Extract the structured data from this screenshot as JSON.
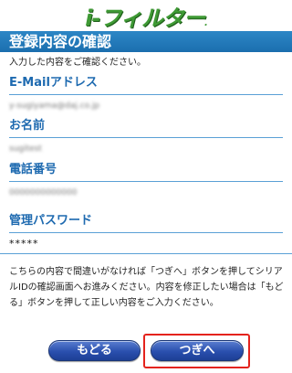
{
  "header": {
    "logo_text": "i-フィルター",
    "logo_mark": "."
  },
  "title": "登録内容の確認",
  "intro": "入力した内容をご確認ください。",
  "fields": [
    {
      "label": "E-Mailアドレス",
      "value": "y-sugiyama@daj.co.jp"
    },
    {
      "label": "お名前",
      "value": "sugitest"
    },
    {
      "label": "電話番号",
      "value": "0000000000000"
    },
    {
      "label": "管理パスワード",
      "value": "*****"
    }
  ],
  "note": "こちらの内容で間違いがなければ「つぎへ」ボタンを押してシリアルIDの確認画面へお進みください。内容を修正したい場合は「もどる」ボタンを押して正しい内容をご入力ください。",
  "buttons": {
    "back": "もどる",
    "next": "つぎへ"
  },
  "colors": {
    "accent": "#1e6ab0",
    "title_bar": "#2d87c6",
    "logo": "#3f9a35",
    "highlight": "#e4231c"
  }
}
